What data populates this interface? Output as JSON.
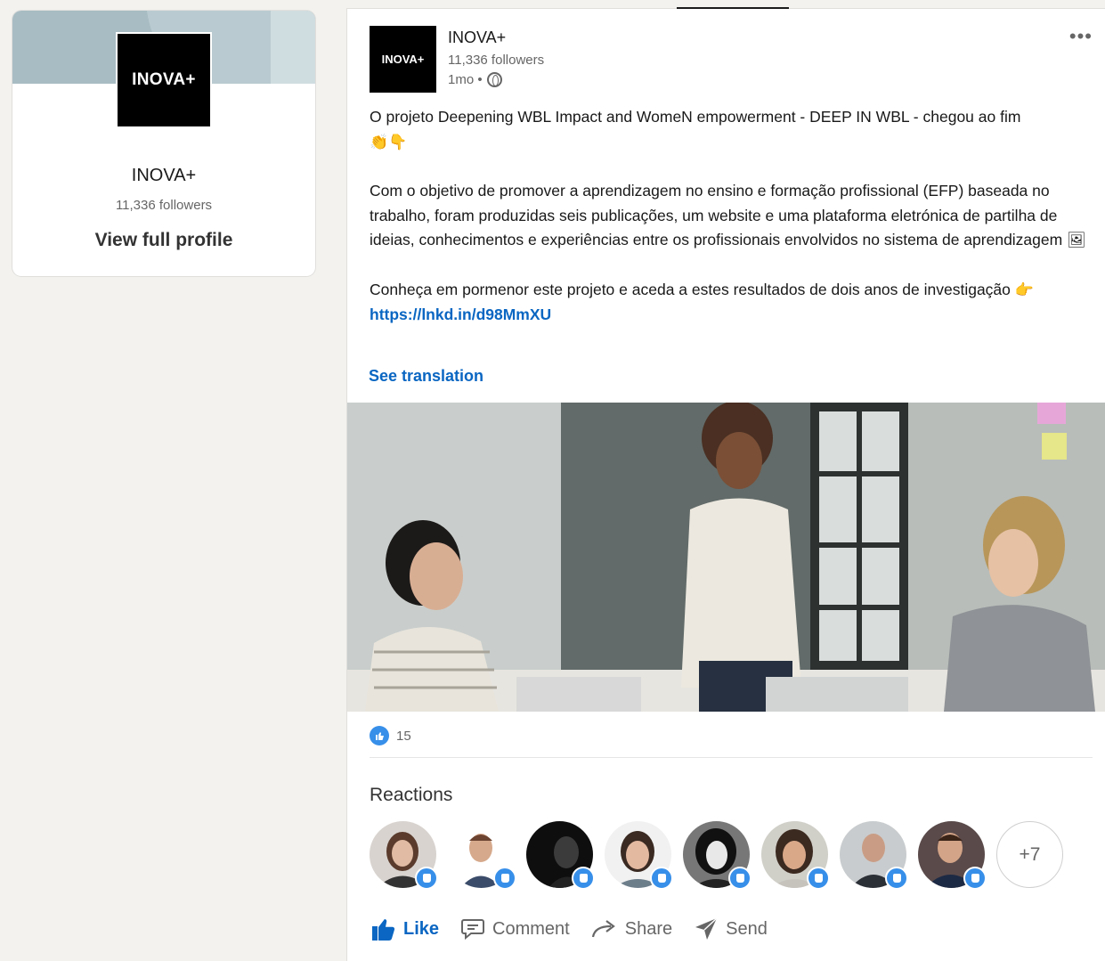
{
  "profile": {
    "logo_text": "INOVA+",
    "name": "INOVA+",
    "followers": "11,336 followers",
    "view_profile": "View full profile"
  },
  "post": {
    "logo_text": "INOVA+",
    "author": "INOVA+",
    "followers": "11,336 followers",
    "time": "1mo •",
    "paragraphs": {
      "p1": "O projeto Deepening WBL Impact and WomeN empowerment - DEEP IN WBL - chegou ao fim",
      "p1_emoji": "👏👇",
      "p2": "Com o objetivo de promover a aprendizagem no ensino e formação profissional (EFP) baseada no trabalho, foram produzidas seis publicações, um website e uma plataforma eletrónica de partilha de ideias, conhecimentos e experiências entre os profissionais envolvidos no sistema de aprendizagem",
      "p2_emoji": "🖼",
      "p3": "Conheça em pormenor este projeto e aceda a estes resultados de dois anos de investigação",
      "p3_emoji": "👉",
      "link": "https://lnkd.in/d98MmXU"
    },
    "see_translation": "See translation",
    "reaction_count": "15",
    "reactions_title": "Reactions",
    "more_reactors": "+7",
    "actions": {
      "like": "Like",
      "comment": "Comment",
      "share": "Share",
      "send": "Send"
    }
  },
  "colors": {
    "accent": "#0a66c2",
    "like_badge": "#378fe9",
    "background": "#f3f2ef"
  }
}
